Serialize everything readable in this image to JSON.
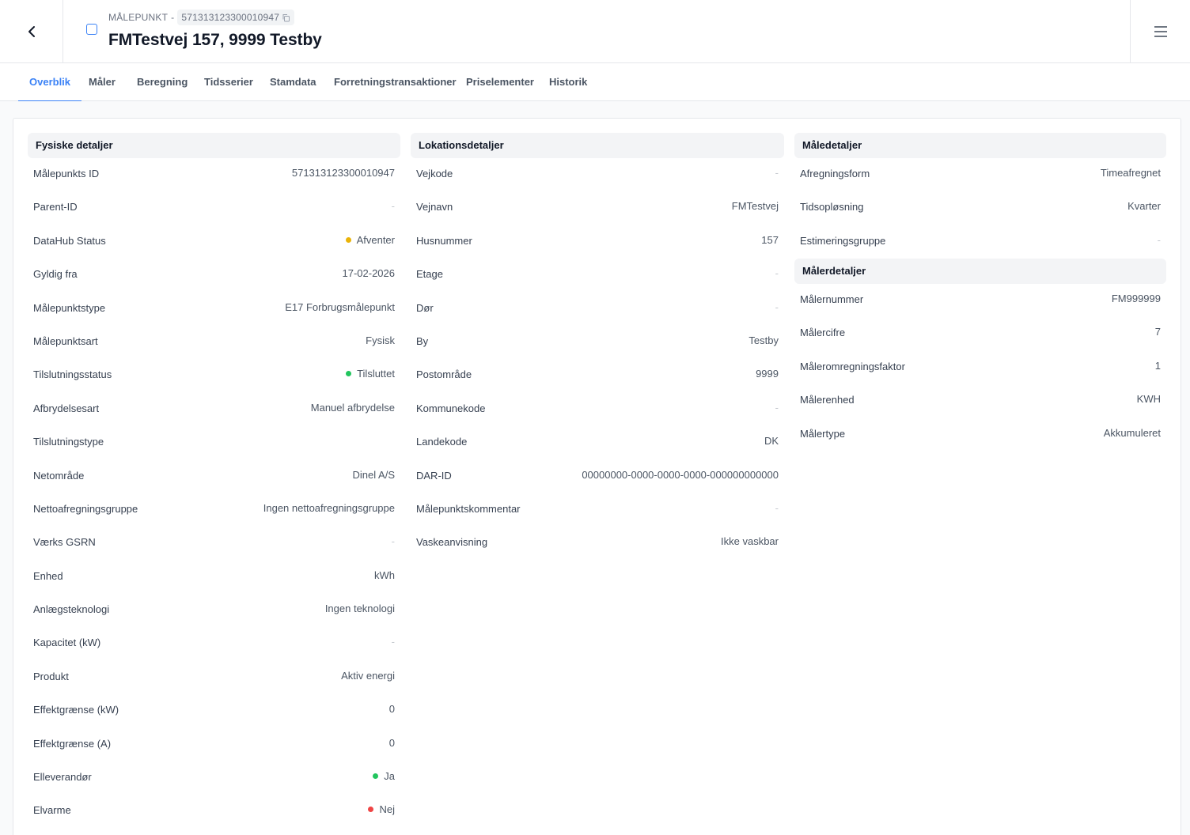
{
  "header": {
    "eyebrow_label": "MÅLEPUNKT",
    "eyebrow_separator": "-",
    "metering_point_id": "571313123300010947",
    "title": "FMTestvej 157, 9999 Testby"
  },
  "tabs": [
    {
      "label": "Overblik",
      "active": true
    },
    {
      "label": "Måler"
    },
    {
      "label": "Beregning"
    },
    {
      "label": "Tidsserier"
    },
    {
      "label": "Stamdata"
    },
    {
      "label": "Forretningstransaktioner"
    },
    {
      "label": "Priselementer"
    },
    {
      "label": "Historik"
    }
  ],
  "status_colors": {
    "yellow": "#eab308",
    "green": "#22c55e",
    "red": "#ef4444",
    "accent": "#3b82f6"
  },
  "physical": {
    "title": "Fysiske detaljer",
    "rows": [
      {
        "label": "Målepunkts ID",
        "value": "571313123300010947"
      },
      {
        "label": "Parent-ID",
        "value": "-"
      },
      {
        "label": "DataHub Status",
        "value": "Afventer",
        "status": "yellow"
      },
      {
        "label": "Gyldig fra",
        "value": "17-02-2026"
      },
      {
        "label": "Målepunktstype",
        "value": "E17 Forbrugsmålepunkt"
      },
      {
        "label": "Målepunktsart",
        "value": "Fysisk"
      },
      {
        "label": "Tilslutningsstatus",
        "value": "Tilsluttet",
        "status": "green"
      },
      {
        "label": "Afbrydelsesart",
        "value": "Manuel afbrydelse"
      },
      {
        "label": "Tilslutningstype",
        "value": ""
      },
      {
        "label": "Netområde",
        "value": "Dinel A/S"
      },
      {
        "label": "Nettoafregningsgruppe",
        "value": "Ingen nettoafregningsgruppe"
      },
      {
        "label": "Værks GSRN",
        "value": "-"
      },
      {
        "label": "Enhed",
        "value": "kWh"
      },
      {
        "label": "Anlægsteknologi",
        "value": "Ingen teknologi"
      },
      {
        "label": "Kapacitet (kW)",
        "value": "-"
      },
      {
        "label": "Produkt",
        "value": "Aktiv energi"
      },
      {
        "label": "Effektgrænse (kW)",
        "value": "0"
      },
      {
        "label": "Effektgrænse (A)",
        "value": "0"
      },
      {
        "label": "Elleverandør",
        "value": "Ja",
        "status": "green"
      },
      {
        "label": "Elvarme",
        "value": "Nej",
        "status": "red"
      }
    ]
  },
  "location": {
    "title": "Lokationsdetaljer",
    "rows": [
      {
        "label": "Vejkode",
        "value": "-"
      },
      {
        "label": "Vejnavn",
        "value": "FMTestvej"
      },
      {
        "label": "Husnummer",
        "value": "157"
      },
      {
        "label": "Etage",
        "value": "-"
      },
      {
        "label": "Dør",
        "value": "-"
      },
      {
        "label": "By",
        "value": "Testby"
      },
      {
        "label": "Postområde",
        "value": "9999"
      },
      {
        "label": "Kommunekode",
        "value": "-"
      },
      {
        "label": "Landekode",
        "value": "DK"
      },
      {
        "label": "DAR-ID",
        "value": "00000000-0000-0000-0000-000000000000"
      },
      {
        "label": "Målepunktskommentar",
        "value": "-"
      },
      {
        "label": "Vaskeanvisning",
        "value": "Ikke vaskbar"
      }
    ]
  },
  "measurement": {
    "title": "Måledetaljer",
    "rows": [
      {
        "label": "Afregningsform",
        "value": "Timeafregnet"
      },
      {
        "label": "Tidsopløsning",
        "value": "Kvarter"
      },
      {
        "label": "Estimeringsgruppe",
        "value": "-"
      }
    ]
  },
  "meter": {
    "title": "Målerdetaljer",
    "rows": [
      {
        "label": "Målernummer",
        "value": "FM999999"
      },
      {
        "label": "Målercifre",
        "value": "7"
      },
      {
        "label": "Måleromregningsfaktor",
        "value": "1"
      },
      {
        "label": "Målerenhed",
        "value": "KWH"
      },
      {
        "label": "Målertype",
        "value": "Akkumuleret"
      }
    ]
  }
}
